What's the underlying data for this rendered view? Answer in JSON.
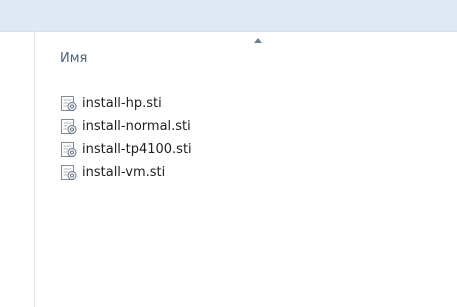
{
  "column_header": {
    "label": "Имя",
    "sort_direction": "ascending"
  },
  "files": [
    {
      "name": "install-hp.sti",
      "icon": "sti-file-icon"
    },
    {
      "name": "install-normal.sti",
      "icon": "sti-file-icon"
    },
    {
      "name": "install-tp4100.sti",
      "icon": "sti-file-icon"
    },
    {
      "name": "install-vm.sti",
      "icon": "sti-file-icon"
    }
  ],
  "colors": {
    "toolbar_bg": "#dfe9f5",
    "header_text": "#4c607a",
    "file_text": "#1f1f1f"
  }
}
